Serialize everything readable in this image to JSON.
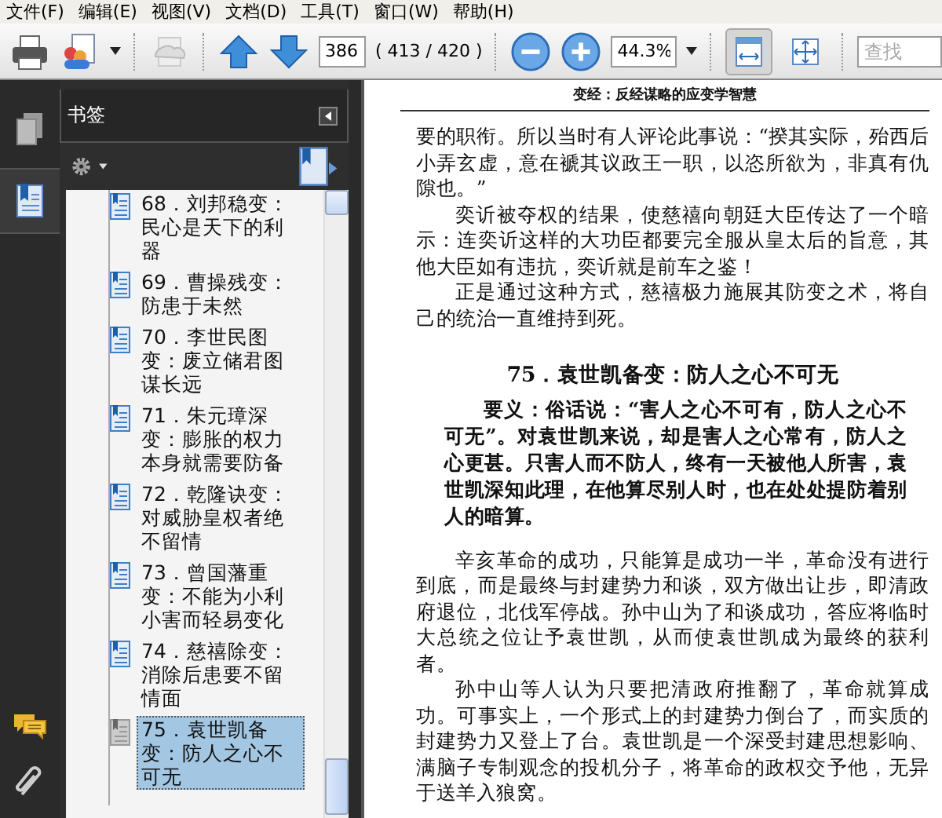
{
  "menu_bar": [
    {
      "label": "文件(F)"
    },
    {
      "label": "编辑(E)"
    },
    {
      "label": "视图(V)"
    },
    {
      "label": "文档(D)"
    },
    {
      "label": "工具(T)"
    },
    {
      "label": "窗口(W)"
    },
    {
      "label": "帮助(H)"
    }
  ],
  "toolbar": {
    "page_number": "386",
    "page_count": "( 413 / 420 )",
    "zoom": "44.3%",
    "search": {
      "placeholder": "查找"
    },
    "view_buttons": [
      {
        "kind": "fit-width",
        "selected": true
      },
      {
        "kind": "fit-page",
        "selected": false
      }
    ]
  },
  "side_tabs": [
    {
      "kind": "pages",
      "selected": false
    },
    {
      "kind": "bookmarks",
      "selected": true
    }
  ],
  "bookmarks_panel": {
    "title": "书签",
    "items": [
      {
        "label": "68．刘邦稳变：民心是天下的利器",
        "selected": false
      },
      {
        "label": "69．曹操残变：防患于未然",
        "selected": false
      },
      {
        "label": "70．李世民图变：废立储君图谋长远",
        "selected": false
      },
      {
        "label": "71．朱元璋深变：膨胀的权力本身就需要防备",
        "selected": false
      },
      {
        "label": "72．乾隆诀变：对威胁皇权者绝不留情",
        "selected": false
      },
      {
        "label": "73．曾国藩重变：不能为小利小害而轻易变化",
        "selected": false
      },
      {
        "label": "74．慈禧除变：消除后患要不留情面",
        "selected": false
      },
      {
        "label": "75．袁世凯备变：防人之心不可无",
        "selected": true
      }
    ]
  },
  "document": {
    "running_header": "变经：反经谋略的应变学智慧",
    "blocks": [
      {
        "kind": "continuation",
        "text": "要的职衔。所以当时有人评论此事说：“揆其实际，殆西后小弄玄虚，意在褫其议政王一职，以恣所欲为，非真有仇隙也。”"
      },
      {
        "kind": "paragraph",
        "text": "奕䜣被夺权的结果，使慈禧向朝廷大臣传达了一个暗示：连奕䜣这样的大功臣都要完全服从皇太后的旨意，其他大臣如有违抗，奕䜣就是前车之鉴！"
      },
      {
        "kind": "paragraph",
        "text": "正是通过这种方式，慈禧极力施展其防变之术，将自己的统治一直维持到死。"
      },
      {
        "kind": "heading",
        "text": "75．袁世凯备变：防人之心不可无"
      },
      {
        "kind": "summary",
        "text": "要义：俗话说：“害人之心不可有，防人之心不可无”。对袁世凯来说，却是害人之心常有，防人之心更甚。只害人而不防人，终有一天被他人所害，袁世凯深知此理，在他算尽别人时，也在处处提防着别人的暗算。"
      },
      {
        "kind": "paragraph",
        "text": "辛亥革命的成功，只能算是成功一半，革命没有进行到底，而是最终与封建势力和谈，双方做出让步，即清政府退位，北伐军停战。孙中山为了和谈成功，答应将临时大总统之位让予袁世凯，从而使袁世凯成为最终的获利者。"
      },
      {
        "kind": "paragraph",
        "text": "孙中山等人认为只要把清政府推翻了，革命就算成功。可事实上，一个形式上的封建势力倒台了，而实质的封建势力又登上了台。袁世凯是一个深受封建思想影响、满脑子专制观念的投机分子，将革命的政权交予他，无异于送羊入狼窝。"
      }
    ]
  }
}
